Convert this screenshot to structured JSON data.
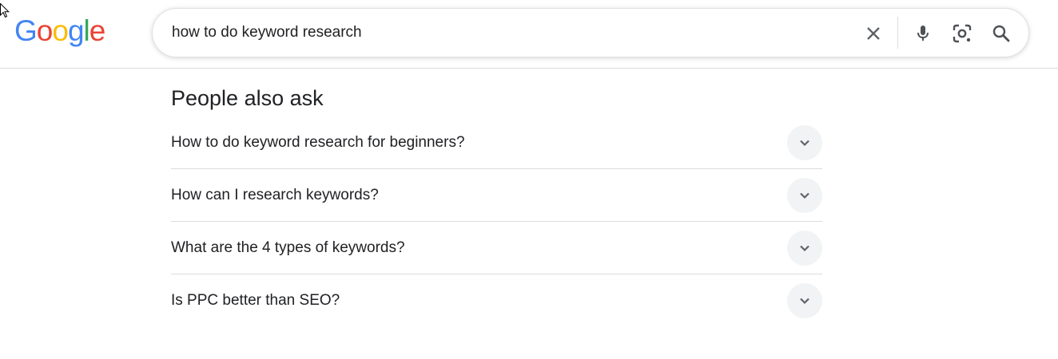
{
  "logo": {
    "letters": [
      "G",
      "o",
      "o",
      "g",
      "l",
      "e"
    ],
    "colors": [
      "#4285F4",
      "#EA4335",
      "#FBBC05",
      "#4285F4",
      "#34A853",
      "#EA4335"
    ]
  },
  "search": {
    "query": "how to do keyword research",
    "icons": [
      "close-icon",
      "mic-icon",
      "lens-icon",
      "search-icon"
    ]
  },
  "paa": {
    "title": "People also ask",
    "questions": [
      "How to do keyword research for beginners?",
      "How can I research keywords?",
      "What are the 4 types of keywords?",
      "Is PPC better than SEO?"
    ]
  }
}
